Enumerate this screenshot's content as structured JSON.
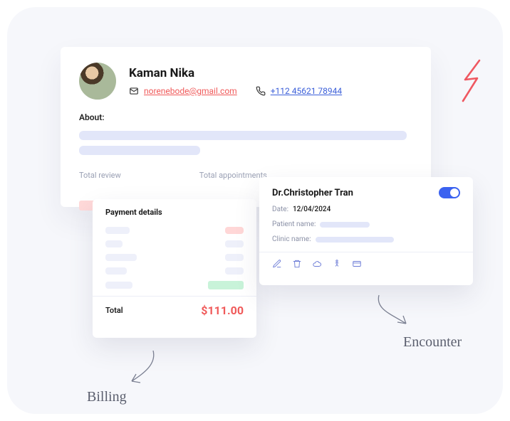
{
  "profile": {
    "name": "Kaman Nika",
    "email": "norenebode@gmail.com",
    "phone": "+112 45621 78944",
    "about_label": "About:",
    "stats": {
      "review": "Total review",
      "appointments": "Total appointments"
    }
  },
  "payment": {
    "title": "Payment details",
    "total_label": "Total",
    "total_value": "$111.00"
  },
  "encounter": {
    "doctor": "Dr.Christopher Tran",
    "date_label": "Date:",
    "date_value": "12/04/2024",
    "patient_label": "Patient name:",
    "clinic_label": "Clinic name:",
    "toggle_on": true
  },
  "annotations": {
    "billing": "Billing",
    "encounter": "Encounter"
  }
}
